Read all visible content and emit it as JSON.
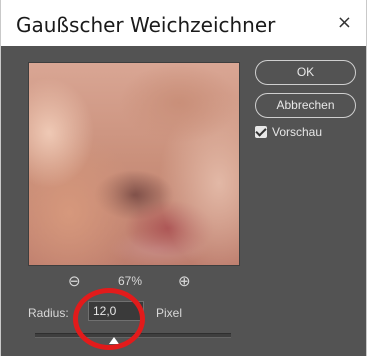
{
  "window": {
    "title": "Gaußscher Weichzeichner",
    "close_glyph": "×"
  },
  "buttons": {
    "ok": "OK",
    "cancel": "Abbrechen"
  },
  "preview_checkbox": {
    "label": "Vorschau",
    "checked": true
  },
  "zoom": {
    "out_glyph": "⊖",
    "level": "67%",
    "in_glyph": "⊕"
  },
  "radius": {
    "label": "Radius:",
    "value": "12,0",
    "unit": "Pixel",
    "slider_fraction": 0.4
  },
  "annotation": {
    "color": "#e21b1b"
  }
}
